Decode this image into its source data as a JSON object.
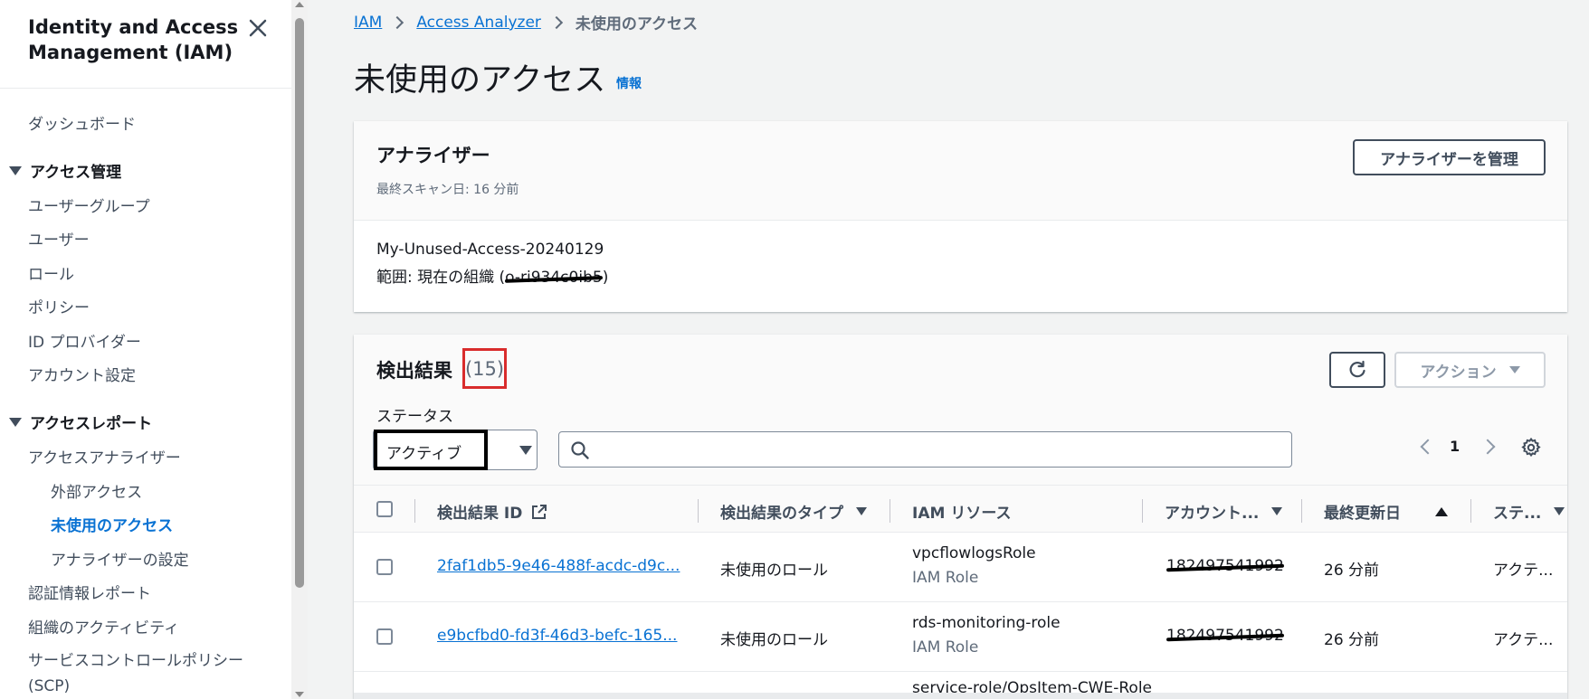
{
  "sidebar": {
    "title": "Identity and Access Management (IAM)",
    "dashboard": "ダッシュボード",
    "access_management": {
      "label": "アクセス管理",
      "items": [
        "ユーザーグループ",
        "ユーザー",
        "ロール",
        "ポリシー",
        "ID プロバイダー",
        "アカウント設定"
      ]
    },
    "access_reports": {
      "label": "アクセスレポート",
      "analyzer": "アクセスアナライザー",
      "analyzer_items": [
        "外部アクセス",
        "未使用のアクセス",
        "アナライザーの設定"
      ],
      "items": [
        "認証情報レポート",
        "組織のアクティビティ",
        "サービスコントロールポリシー (SCP)"
      ]
    }
  },
  "breadcrumb": {
    "items": [
      "IAM",
      "Access Analyzer"
    ],
    "current": "未使用のアクセス"
  },
  "page": {
    "title": "未使用のアクセス",
    "info": "情報"
  },
  "analyzer": {
    "heading": "アナライザー",
    "last_scan": "最終スキャン日: 16 分前",
    "manage_button": "アナライザーを管理",
    "name": "My-Unused-Access-20240129",
    "scope_label": "範囲: 現在の組織 (",
    "scope_org": "o-ri934c0ib5",
    "scope_end": ")"
  },
  "findings": {
    "heading": "検出結果",
    "count": "(15)",
    "action_button": "アクション",
    "status_label": "ステータス",
    "status_value": "アクティブ",
    "search_placeholder": "",
    "page": "1",
    "columns": [
      "検出結果 ID",
      "検出結果のタイプ",
      "IAM リソース",
      "アカウント...",
      "最終更新日",
      "ステ..."
    ],
    "rows": [
      {
        "id": "2faf1db5-9e46-488f-acdc-d9c...",
        "type": "未使用のロール",
        "resource": "vpcflowlogsRole",
        "resource_type": "IAM Role",
        "account": "182497541992",
        "updated": "26 分前",
        "status": "アクテ..."
      },
      {
        "id": "e9bcfbd0-fd3f-46d3-befc-165...",
        "type": "未使用のロール",
        "resource": "rds-monitoring-role",
        "resource_type": "IAM Role",
        "account": "182497541992",
        "updated": "26 分前",
        "status": "アクテ..."
      },
      {
        "resource": "service-role/OpsItem-CWE-Role"
      }
    ]
  },
  "colors": {
    "link": "#0972d3",
    "highlight_red": "#d92c2c",
    "text": "#16191f"
  }
}
